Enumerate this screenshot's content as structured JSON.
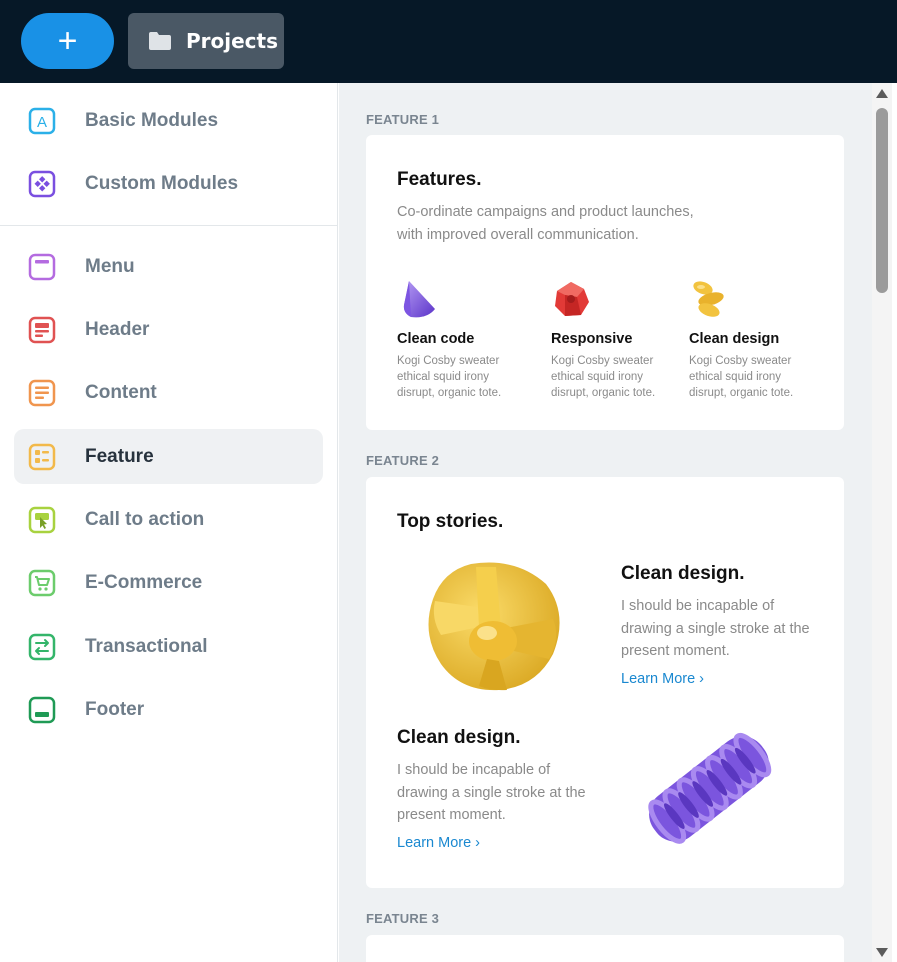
{
  "topbar": {
    "add_label": "+",
    "projects_label": "Projects"
  },
  "sidebar": {
    "top_items": [
      {
        "label": "Basic Modules",
        "icon": "basic-modules-icon",
        "color": "#2bb0e8"
      },
      {
        "label": "Custom Modules",
        "icon": "custom-modules-icon",
        "color": "#7a4fe0"
      }
    ],
    "items": [
      {
        "label": "Menu",
        "icon": "menu-icon",
        "color": "#b46be0"
      },
      {
        "label": "Header",
        "icon": "header-icon",
        "color": "#e05252"
      },
      {
        "label": "Content",
        "icon": "content-icon",
        "color": "#f0954e"
      },
      {
        "label": "Feature",
        "icon": "feature-icon",
        "color": "#f2b94a",
        "active": true
      },
      {
        "label": "Call to action",
        "icon": "call-to-action-icon",
        "color": "#a8d23f"
      },
      {
        "label": "E-Commerce",
        "icon": "e-commerce-icon",
        "color": "#6ccc6c"
      },
      {
        "label": "Transactional",
        "icon": "transactional-icon",
        "color": "#34b56a"
      },
      {
        "label": "Footer",
        "icon": "footer-icon",
        "color": "#1f9a55"
      }
    ]
  },
  "main": {
    "feature1": {
      "section_label": "FEATURE 1",
      "title": "Features.",
      "subtitle": "Co-ordinate campaigns and product launches, with improved overall communication.",
      "columns": [
        {
          "title": "Clean code",
          "desc": "Kogi Cosby sweater ethical squid irony disrupt, organic tote.",
          "shape": "purple-cone"
        },
        {
          "title": "Responsive",
          "desc": "Kogi Cosby sweater ethical squid irony disrupt, organic tote.",
          "shape": "red-gem"
        },
        {
          "title": "Clean design",
          "desc": "Kogi Cosby sweater ethical squid irony disrupt, organic tote.",
          "shape": "yellow-spiral"
        }
      ]
    },
    "feature2": {
      "section_label": "FEATURE 2",
      "title": "Top stories.",
      "block1": {
        "title": "Clean design.",
        "desc": "I should be incapable of drawing a single stroke at the present moment.",
        "link": "Learn More ›"
      },
      "block2": {
        "title": "Clean design.",
        "desc": "I should be incapable of drawing a single stroke at the present moment.",
        "link": "Learn More ›"
      }
    },
    "feature3": {
      "section_label": "FEATURE 3"
    }
  },
  "colors": {
    "topbar_bg": "#061827",
    "accent_blue": "#1991e6",
    "link_blue": "#1a88d0",
    "main_bg": "#eef1f3"
  }
}
